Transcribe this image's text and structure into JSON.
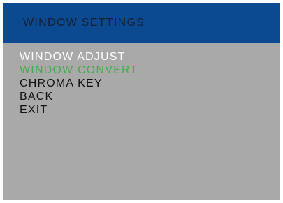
{
  "header": {
    "title": "WINDOW SETTINGS"
  },
  "menu": {
    "items": [
      {
        "label": "WINDOW ADJUST",
        "color": "#ffffff"
      },
      {
        "label": "WINDOW CONVERT",
        "color": "#3fae49"
      },
      {
        "label": "CHROMA KEY",
        "color": "#111111"
      },
      {
        "label": "BACK",
        "color": "#111111"
      },
      {
        "label": "EXIT",
        "color": "#111111"
      }
    ]
  },
  "colors": {
    "header_background": "#0b4a91",
    "panel_background": "#a9a9a9",
    "title_text": "#141f33"
  }
}
